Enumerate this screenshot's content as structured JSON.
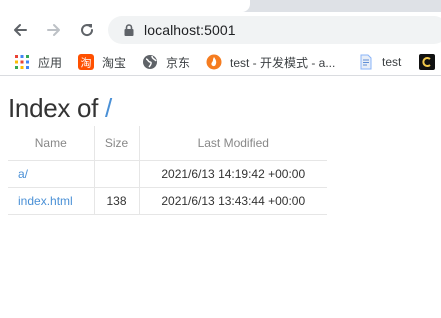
{
  "browser": {
    "url": "localhost:5001",
    "bookmarks": [
      {
        "label": "应用",
        "icon": "apps-grid-icon"
      },
      {
        "label": "淘宝",
        "icon": "taobao-icon"
      },
      {
        "label": "京东",
        "icon": "globe-icon"
      },
      {
        "label": "test - 开发模式 - a...",
        "icon": "flame-icon"
      },
      {
        "label": "test",
        "icon": "document-icon"
      }
    ]
  },
  "page": {
    "title_prefix": "Index of ",
    "title_path": "/",
    "columns": {
      "name": "Name",
      "size": "Size",
      "modified": "Last Modified"
    },
    "rows": [
      {
        "name": "a/",
        "size": "",
        "modified": "2021/6/13 14:19:42 +00:00"
      },
      {
        "name": "index.html",
        "size": "138",
        "modified": "2021/6/13 13:43:44 +00:00"
      }
    ]
  },
  "colors": {
    "link": "#4a90d6",
    "text": "#333333",
    "header": "#888888"
  }
}
